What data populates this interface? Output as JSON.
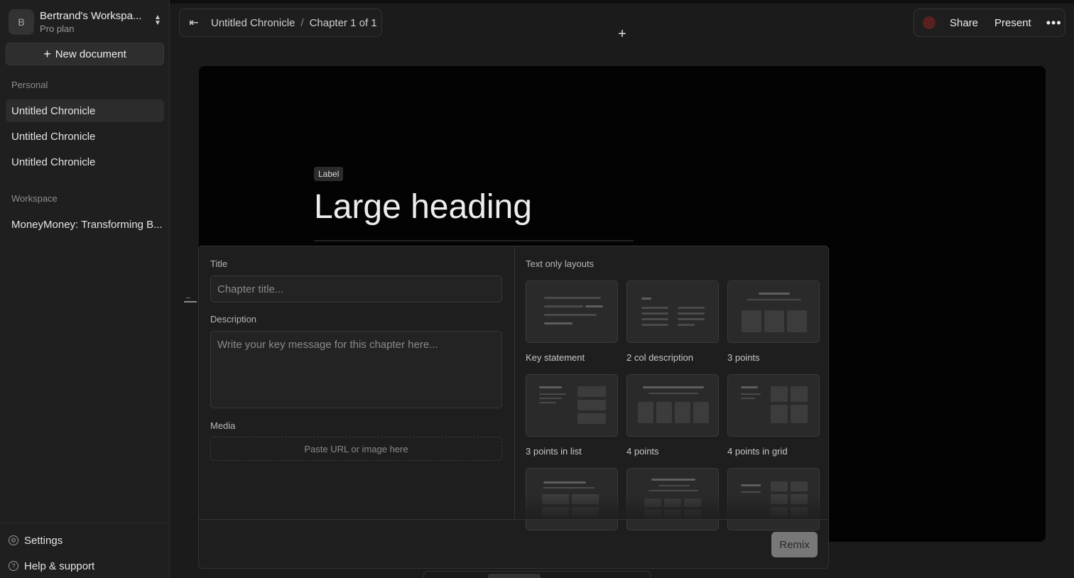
{
  "sidebar": {
    "workspace": {
      "avatar_letter": "B",
      "name": "Bertrand's Workspa...",
      "plan": "Pro plan"
    },
    "new_document_label": "New document",
    "personal_label": "Personal",
    "personal_items": [
      "Untitled Chronicle",
      "Untitled Chronicle",
      "Untitled Chronicle"
    ],
    "workspace_label": "Workspace",
    "workspace_items": [
      "MoneyMoney: Transforming B..."
    ],
    "settings_label": "Settings",
    "help_label": "Help & support"
  },
  "topbar": {
    "breadcrumb": {
      "document": "Untitled Chronicle",
      "separator": "/",
      "chapter": "Chapter 1 of 1"
    },
    "share_label": "Share",
    "present_label": "Present"
  },
  "slide": {
    "label": "Label",
    "heading": "Large heading"
  },
  "panel": {
    "title_label": "Title",
    "title_placeholder": "Chapter title...",
    "description_label": "Description",
    "description_placeholder": "Write your key message for this chapter here...",
    "media_label": "Media",
    "media_placeholder": "Paste URL or image here",
    "layouts_title": "Text only layouts",
    "layouts": [
      "Key statement",
      "2 col description",
      "3 points",
      "3 points in list",
      "4 points",
      "4 points in grid"
    ],
    "remix_label": "Remix"
  },
  "colors": {
    "background": "#1b1b1b",
    "canvas": "#030303",
    "panel": "#1e1e1e",
    "remix": "#787878"
  }
}
